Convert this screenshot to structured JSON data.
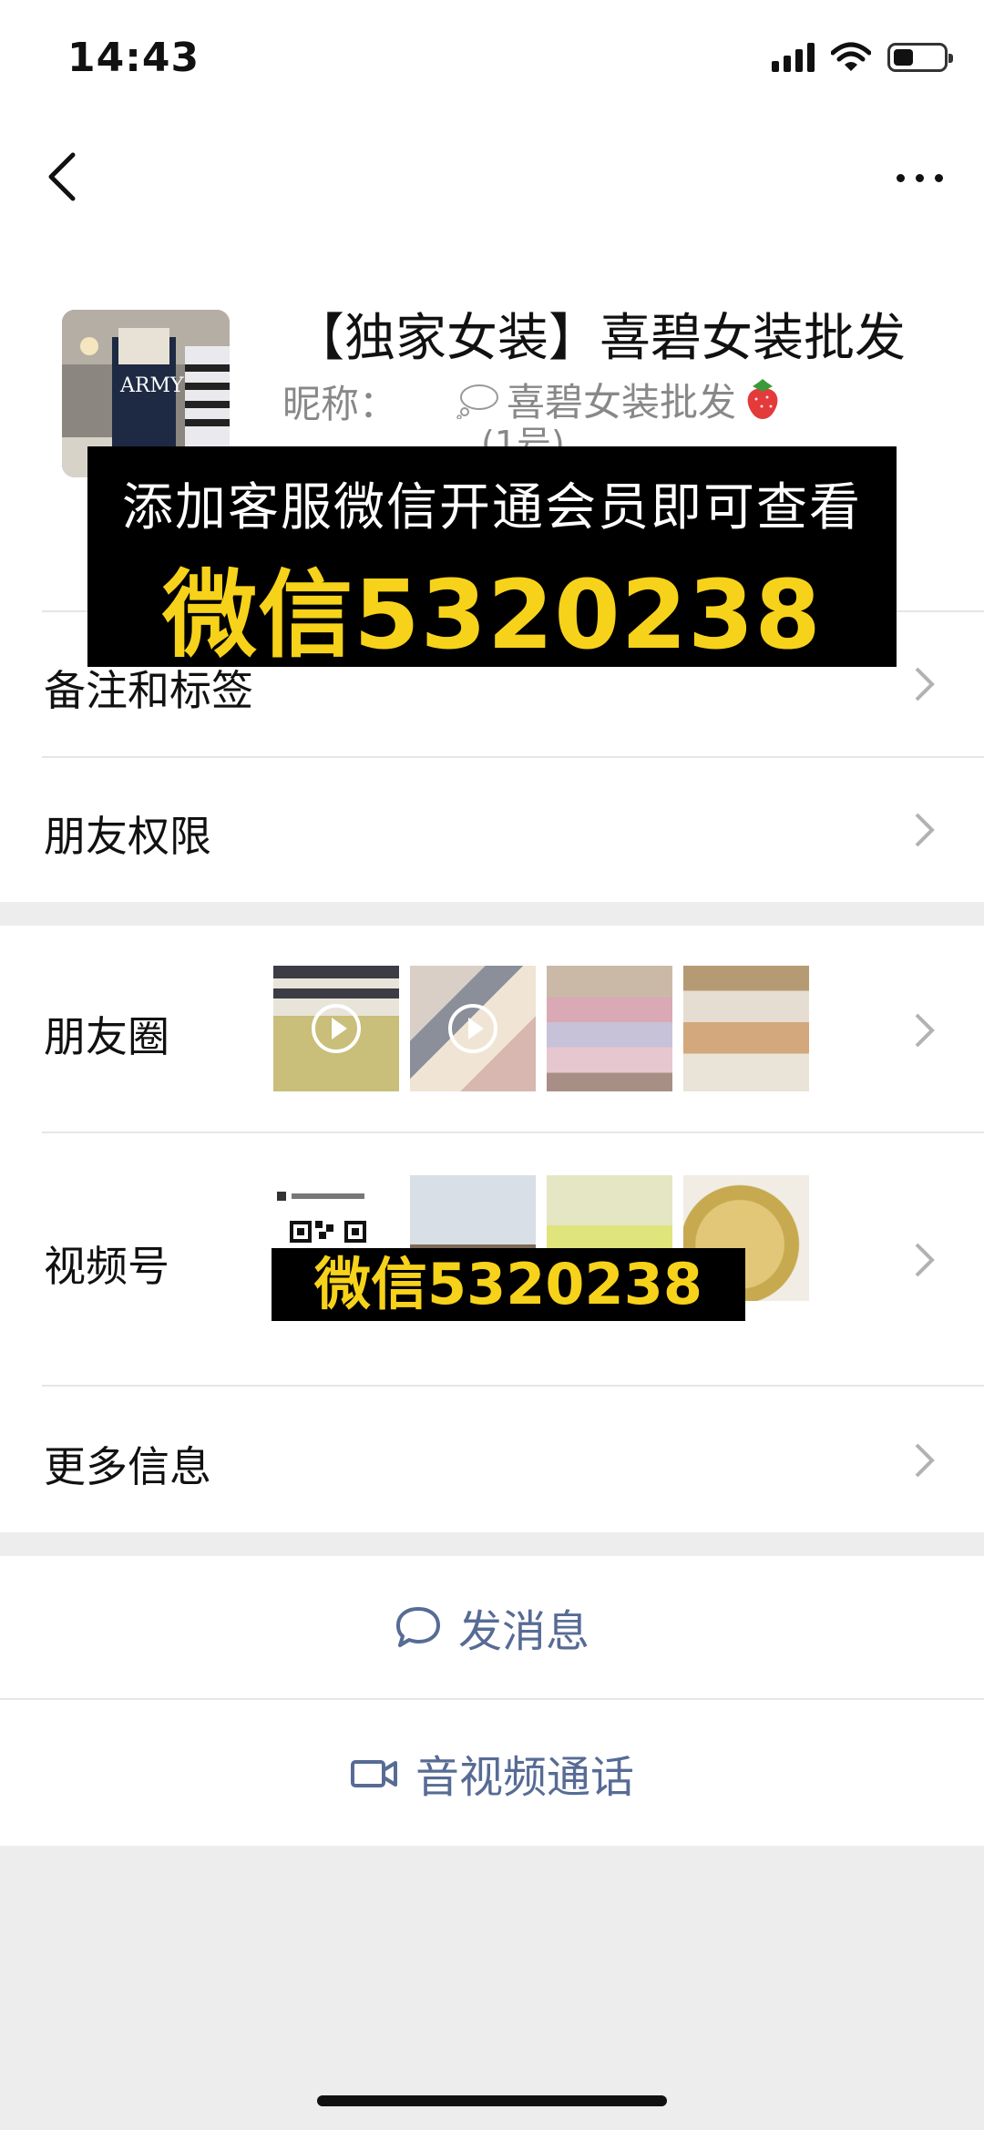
{
  "status_bar": {
    "time": "14:43"
  },
  "profile": {
    "name": "【独家女装】喜碧女装批发",
    "nickname_label": "昵称：",
    "nickname_value": "喜碧女装批发",
    "nickname_suffix": "(1号)",
    "avatar_text": "ARMY"
  },
  "promo": {
    "line1": "添加客服微信开通会员即可查看",
    "line2": "微信5320238"
  },
  "rows": {
    "remarks": "备注和标签",
    "permissions": "朋友权限",
    "moments": "朋友圈",
    "channels": "视频号",
    "more_info": "更多信息"
  },
  "channels_overlay": "微信5320238",
  "actions": {
    "send_message": "发消息",
    "av_call": "音视频通话"
  },
  "colors": {
    "link": "#576b95",
    "promo_yellow": "#f7d21a"
  }
}
